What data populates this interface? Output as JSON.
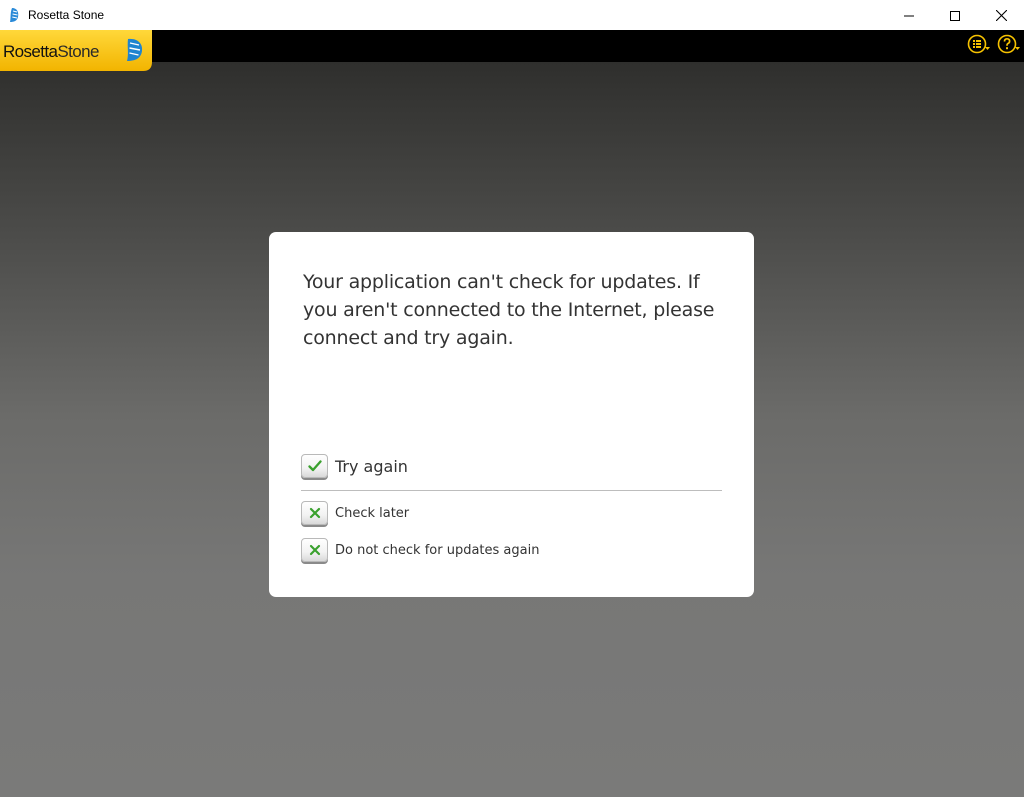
{
  "window": {
    "title": "Rosetta Stone",
    "app_icon": "rosetta-stone-app-icon",
    "controls": [
      "minimize-icon",
      "maximize-icon",
      "close-icon"
    ]
  },
  "toolbar": {
    "logo_word1": "Rosetta",
    "logo_word2": "Stone",
    "logo_mark": "®",
    "icons": [
      "menu-list-icon",
      "help-icon"
    ],
    "accent_color": "#f6c200"
  },
  "dialog": {
    "message": "Your application can't check for updates. If you aren't connected to the Internet, please connect and try again.",
    "options": [
      {
        "label": "Try again",
        "icon": "check-icon",
        "color": "#3aa12e"
      },
      {
        "label": "Check later",
        "icon": "x-icon",
        "color": "#3aa12e"
      },
      {
        "label": "Do not check for updates again",
        "icon": "x-icon",
        "color": "#3aa12e"
      }
    ]
  }
}
